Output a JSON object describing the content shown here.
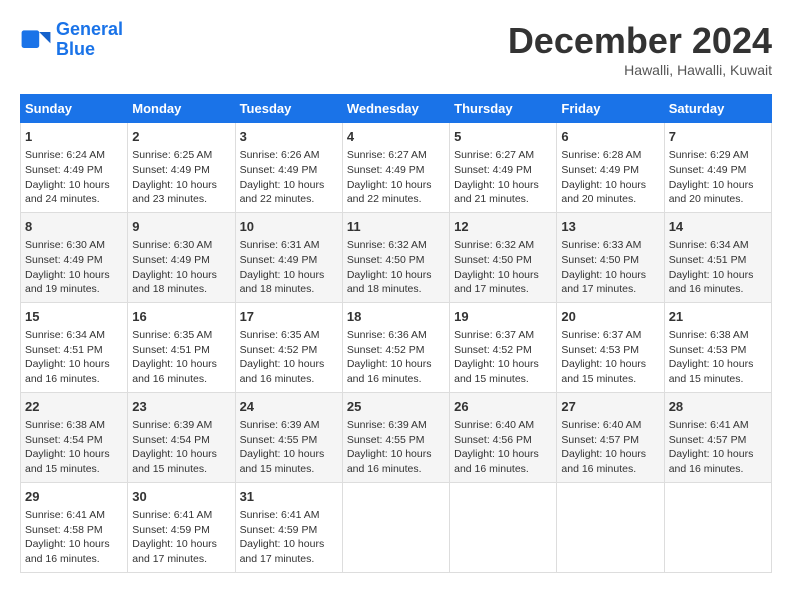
{
  "logo": {
    "line1": "General",
    "line2": "Blue"
  },
  "title": "December 2024",
  "subtitle": "Hawalli, Hawalli, Kuwait",
  "headers": [
    "Sunday",
    "Monday",
    "Tuesday",
    "Wednesday",
    "Thursday",
    "Friday",
    "Saturday"
  ],
  "weeks": [
    [
      {
        "day": "1",
        "info": "Sunrise: 6:24 AM\nSunset: 4:49 PM\nDaylight: 10 hours and 24 minutes."
      },
      {
        "day": "2",
        "info": "Sunrise: 6:25 AM\nSunset: 4:49 PM\nDaylight: 10 hours and 23 minutes."
      },
      {
        "day": "3",
        "info": "Sunrise: 6:26 AM\nSunset: 4:49 PM\nDaylight: 10 hours and 22 minutes."
      },
      {
        "day": "4",
        "info": "Sunrise: 6:27 AM\nSunset: 4:49 PM\nDaylight: 10 hours and 22 minutes."
      },
      {
        "day": "5",
        "info": "Sunrise: 6:27 AM\nSunset: 4:49 PM\nDaylight: 10 hours and 21 minutes."
      },
      {
        "day": "6",
        "info": "Sunrise: 6:28 AM\nSunset: 4:49 PM\nDaylight: 10 hours and 20 minutes."
      },
      {
        "day": "7",
        "info": "Sunrise: 6:29 AM\nSunset: 4:49 PM\nDaylight: 10 hours and 20 minutes."
      }
    ],
    [
      {
        "day": "8",
        "info": "Sunrise: 6:30 AM\nSunset: 4:49 PM\nDaylight: 10 hours and 19 minutes."
      },
      {
        "day": "9",
        "info": "Sunrise: 6:30 AM\nSunset: 4:49 PM\nDaylight: 10 hours and 18 minutes."
      },
      {
        "day": "10",
        "info": "Sunrise: 6:31 AM\nSunset: 4:49 PM\nDaylight: 10 hours and 18 minutes."
      },
      {
        "day": "11",
        "info": "Sunrise: 6:32 AM\nSunset: 4:50 PM\nDaylight: 10 hours and 18 minutes."
      },
      {
        "day": "12",
        "info": "Sunrise: 6:32 AM\nSunset: 4:50 PM\nDaylight: 10 hours and 17 minutes."
      },
      {
        "day": "13",
        "info": "Sunrise: 6:33 AM\nSunset: 4:50 PM\nDaylight: 10 hours and 17 minutes."
      },
      {
        "day": "14",
        "info": "Sunrise: 6:34 AM\nSunset: 4:51 PM\nDaylight: 10 hours and 16 minutes."
      }
    ],
    [
      {
        "day": "15",
        "info": "Sunrise: 6:34 AM\nSunset: 4:51 PM\nDaylight: 10 hours and 16 minutes."
      },
      {
        "day": "16",
        "info": "Sunrise: 6:35 AM\nSunset: 4:51 PM\nDaylight: 10 hours and 16 minutes."
      },
      {
        "day": "17",
        "info": "Sunrise: 6:35 AM\nSunset: 4:52 PM\nDaylight: 10 hours and 16 minutes."
      },
      {
        "day": "18",
        "info": "Sunrise: 6:36 AM\nSunset: 4:52 PM\nDaylight: 10 hours and 16 minutes."
      },
      {
        "day": "19",
        "info": "Sunrise: 6:37 AM\nSunset: 4:52 PM\nDaylight: 10 hours and 15 minutes."
      },
      {
        "day": "20",
        "info": "Sunrise: 6:37 AM\nSunset: 4:53 PM\nDaylight: 10 hours and 15 minutes."
      },
      {
        "day": "21",
        "info": "Sunrise: 6:38 AM\nSunset: 4:53 PM\nDaylight: 10 hours and 15 minutes."
      }
    ],
    [
      {
        "day": "22",
        "info": "Sunrise: 6:38 AM\nSunset: 4:54 PM\nDaylight: 10 hours and 15 minutes."
      },
      {
        "day": "23",
        "info": "Sunrise: 6:39 AM\nSunset: 4:54 PM\nDaylight: 10 hours and 15 minutes."
      },
      {
        "day": "24",
        "info": "Sunrise: 6:39 AM\nSunset: 4:55 PM\nDaylight: 10 hours and 15 minutes."
      },
      {
        "day": "25",
        "info": "Sunrise: 6:39 AM\nSunset: 4:55 PM\nDaylight: 10 hours and 16 minutes."
      },
      {
        "day": "26",
        "info": "Sunrise: 6:40 AM\nSunset: 4:56 PM\nDaylight: 10 hours and 16 minutes."
      },
      {
        "day": "27",
        "info": "Sunrise: 6:40 AM\nSunset: 4:57 PM\nDaylight: 10 hours and 16 minutes."
      },
      {
        "day": "28",
        "info": "Sunrise: 6:41 AM\nSunset: 4:57 PM\nDaylight: 10 hours and 16 minutes."
      }
    ],
    [
      {
        "day": "29",
        "info": "Sunrise: 6:41 AM\nSunset: 4:58 PM\nDaylight: 10 hours and 16 minutes."
      },
      {
        "day": "30",
        "info": "Sunrise: 6:41 AM\nSunset: 4:59 PM\nDaylight: 10 hours and 17 minutes."
      },
      {
        "day": "31",
        "info": "Sunrise: 6:41 AM\nSunset: 4:59 PM\nDaylight: 10 hours and 17 minutes."
      },
      null,
      null,
      null,
      null
    ]
  ]
}
